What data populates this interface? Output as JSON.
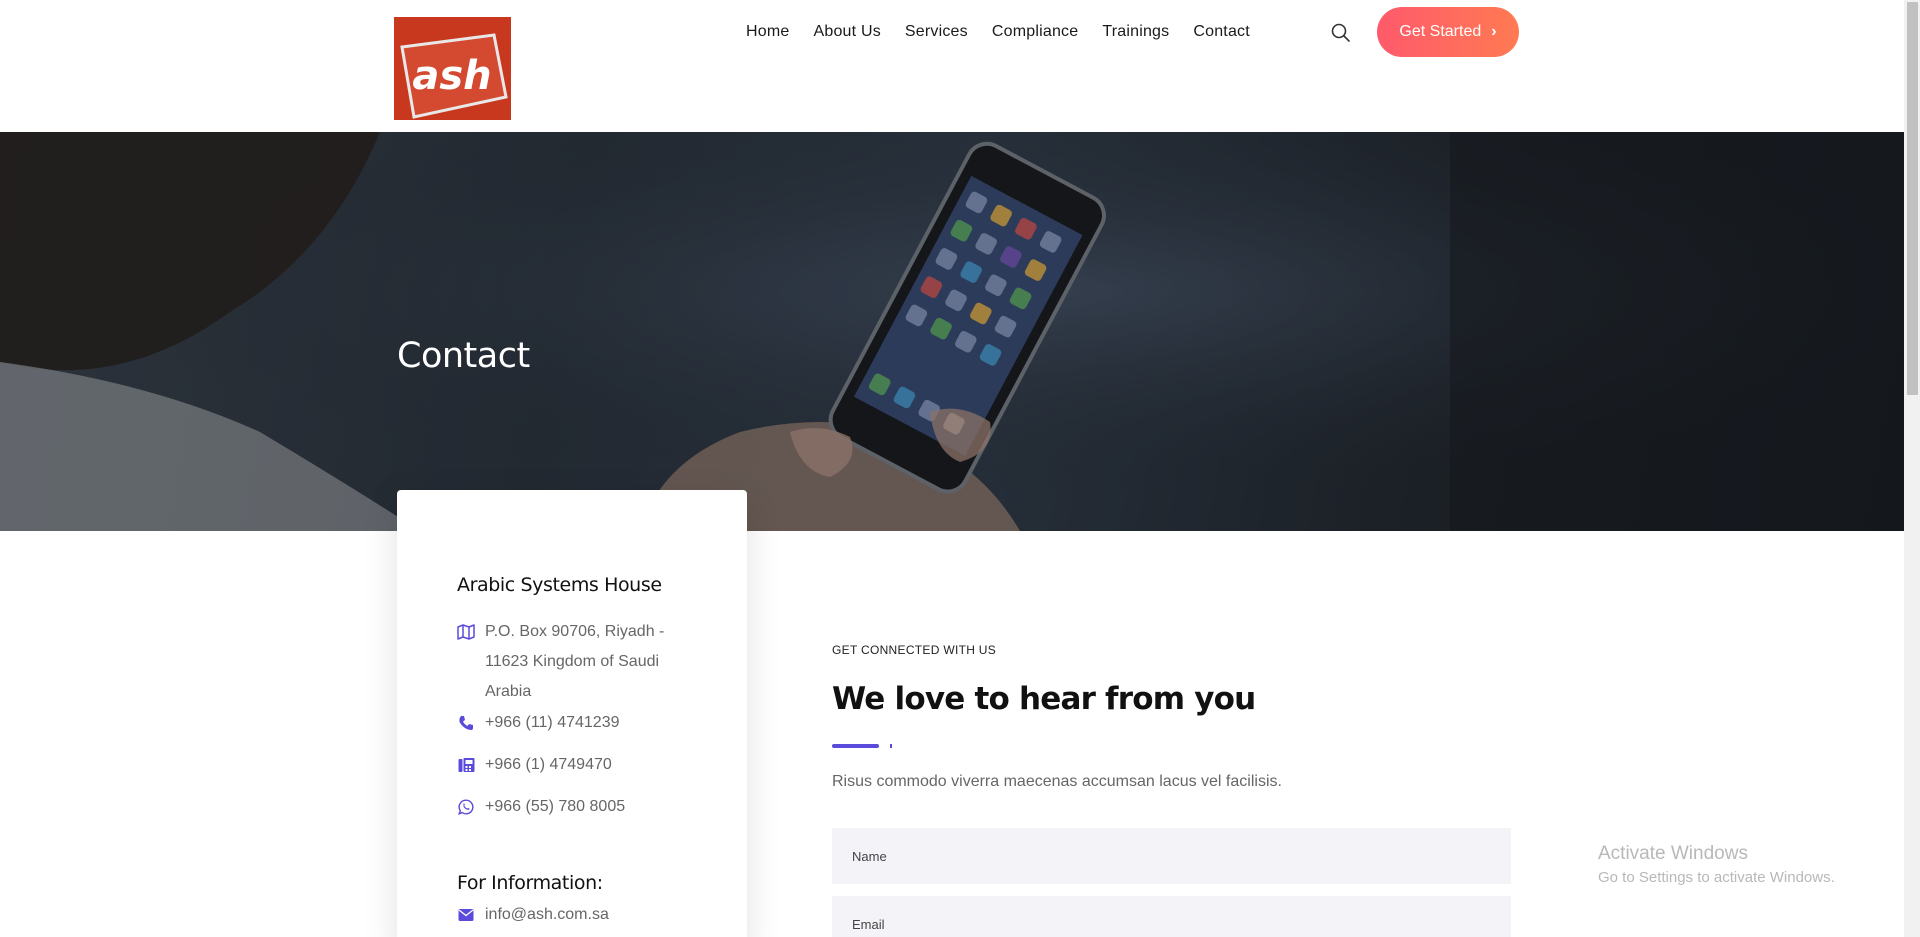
{
  "header": {
    "logo_text": "ash",
    "nav": [
      "Home",
      "About Us",
      "Services",
      "Compliance",
      "Trainings",
      "Contact"
    ],
    "cta_label": "Get Started"
  },
  "hero": {
    "title": "Contact"
  },
  "card": {
    "title": "Arabic Systems House",
    "address": "P.O. Box 90706, Riyadh - 11623 Kingdom of Saudi Arabia",
    "phone": "+966 (11) 4741239",
    "fax": "+966 (1) 4749470",
    "whatsapp": "+966 (55) 780 8005",
    "info_heading": "For Information:",
    "email": "info@ash.com.sa"
  },
  "form": {
    "eyebrow": "GET CONNECTED WITH US",
    "title": "We love to hear from you",
    "description": "Risus commodo viverra maecenas accumsan lacus vel facilisis.",
    "name_placeholder": "Name",
    "email_placeholder": "Email"
  },
  "watermark": {
    "line1": "Activate Windows",
    "line2": "Go to Settings to activate Windows."
  },
  "colors": {
    "accent": "#5b4bdb",
    "cta_start": "#ff5a6c",
    "cta_end": "#ff7a52",
    "field_bg": "#f4f3f8"
  }
}
